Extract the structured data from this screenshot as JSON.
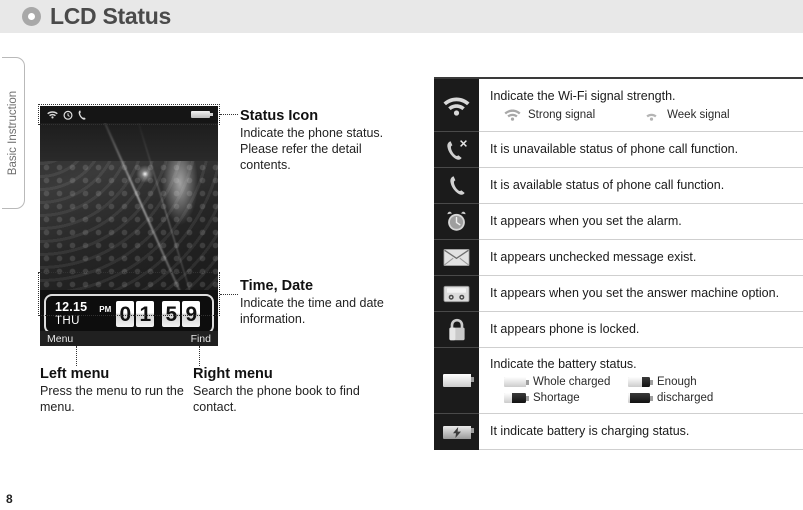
{
  "header": {
    "title": "LCD Status",
    "bullet_icon": "filled-circle-icon"
  },
  "side_tab": {
    "label": "Basic Instruction"
  },
  "page_number": "8",
  "phone": {
    "status_bar": {
      "icons": [
        "wifi-icon",
        "alarm-clock-icon",
        "phone-handset-icon"
      ],
      "battery_icon": "battery-full-icon"
    },
    "clock_widget": {
      "date": "12.15",
      "weekday": "THU",
      "meridiem": "PM",
      "hour_digits": [
        "0",
        "1"
      ],
      "minute_digits": [
        "5",
        "9"
      ]
    },
    "softkeys": {
      "left": "Menu",
      "right": "Find"
    }
  },
  "annotations": [
    {
      "id": "status-icon",
      "title": "Status Icon",
      "body": "Indicate the phone status. Please refer the detail contents."
    },
    {
      "id": "time-date",
      "title": "Time, Date",
      "body": "Indicate the time and date information."
    },
    {
      "id": "left-menu",
      "title": "Left menu",
      "body": "Press the menu to run the menu."
    },
    {
      "id": "right-menu",
      "title": "Right menu",
      "body": "Search the phone book to find contact."
    }
  ],
  "status_table": {
    "rows": [
      {
        "icon": "wifi-icon",
        "text": "Indicate the Wi-Fi signal strength.",
        "sub_items": [
          {
            "icon": "wifi-strong-icon",
            "label": "Strong signal"
          },
          {
            "icon": "wifi-weak-icon",
            "label": "Week signal"
          }
        ]
      },
      {
        "icon": "phone-call-unavailable-icon",
        "text": "It is unavailable status of phone call function.",
        "sub_items": []
      },
      {
        "icon": "phone-call-available-icon",
        "text": "It is available status of phone call function.",
        "sub_items": []
      },
      {
        "icon": "alarm-clock-icon",
        "text": "It appears when you set the alarm.",
        "sub_items": []
      },
      {
        "icon": "envelope-icon",
        "text": "It appears unchecked message exist.",
        "sub_items": []
      },
      {
        "icon": "answer-machine-icon",
        "text": "It appears when you set the answer machine option.",
        "sub_items": []
      },
      {
        "icon": "padlock-icon",
        "text": "It appears phone is locked.",
        "sub_items": []
      },
      {
        "icon": "battery-icon",
        "text": "Indicate the battery status.",
        "sub_items": [
          {
            "icon": "battery-full-icon",
            "label": "Whole charged",
            "level": 100
          },
          {
            "icon": "battery-enough-icon",
            "label": "Enough",
            "level": 62
          },
          {
            "icon": "battery-shortage-icon",
            "label": "Shortage",
            "level": 38
          },
          {
            "icon": "battery-discharged-icon",
            "label": "discharged",
            "level": 8
          }
        ]
      },
      {
        "icon": "battery-charging-icon",
        "text": "It indicate battery is charging status.",
        "sub_items": []
      }
    ]
  },
  "colors": {
    "header_bg": "#e8e8e8",
    "icon_cell_bg": "#1b1b1b",
    "row_border": "#cfcfcf",
    "text": "#1a1a1a"
  }
}
